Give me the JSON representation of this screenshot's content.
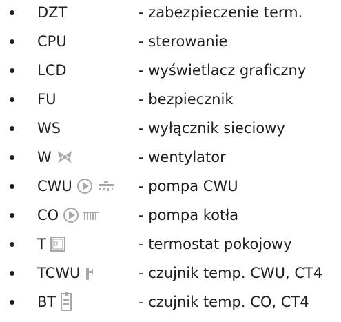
{
  "items": [
    {
      "abbr": "DZT",
      "desc": "- zabezpieczenie term.",
      "icons": []
    },
    {
      "abbr": "CPU",
      "desc": "- sterowanie",
      "icons": []
    },
    {
      "abbr": "LCD",
      "desc": "- wyświetlacz graficzny",
      "icons": []
    },
    {
      "abbr": "FU",
      "desc": "- bezpiecznik",
      "icons": []
    },
    {
      "abbr": "WS",
      "desc": "- wyłącznik sieciowy",
      "icons": []
    },
    {
      "abbr": "W",
      "desc": "- wentylator",
      "icons": [
        "fan-icon"
      ]
    },
    {
      "abbr": "CWU",
      "desc": "- pompa CWU",
      "icons": [
        "pump-icon",
        "faucet-icon"
      ]
    },
    {
      "abbr": "CO",
      "desc": "- pompa kotła",
      "icons": [
        "pump-icon",
        "radiator-icon"
      ]
    },
    {
      "abbr": "T",
      "desc": "- termostat pokojowy",
      "icons": [
        "thermostat-icon"
      ]
    },
    {
      "abbr": "TCWU",
      "desc": "- czujnik temp. CWU, CT4",
      "icons": [
        "water-sensor-icon"
      ]
    },
    {
      "abbr": "BT",
      "desc": "- czujnik temp. CO, CT4",
      "icons": [
        "boiler-sensor-icon"
      ]
    }
  ],
  "colors": {
    "text": "#1f1f1f",
    "icon": "#a8a8a8"
  }
}
